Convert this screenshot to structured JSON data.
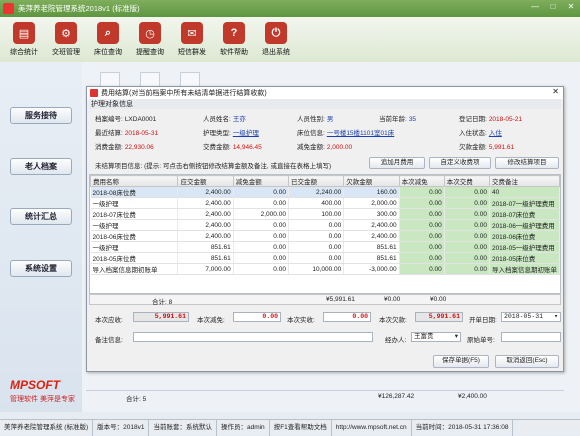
{
  "app": {
    "title": "美萍养老院管理系统2018v1 (标准版)",
    "min": "—",
    "max": "□",
    "close": "✕"
  },
  "toolbar": [
    {
      "label": "综合统计",
      "icon": "chart-icon",
      "color": "#c0392b"
    },
    {
      "label": "交班管理",
      "icon": "handover-icon",
      "color": "#c0392b"
    },
    {
      "label": "床位查询",
      "icon": "bed-search-icon",
      "color": "#c0392b"
    },
    {
      "label": "提醒查询",
      "icon": "reminder-icon",
      "color": "#c0392b"
    },
    {
      "label": "短信群发",
      "icon": "sms-icon",
      "color": "#c0392b"
    },
    {
      "label": "软件帮助",
      "icon": "help-icon",
      "color": "#c0392b"
    },
    {
      "label": "退出系统",
      "icon": "exit-icon",
      "color": "#c0392b"
    }
  ],
  "sidebar": [
    "服务接待",
    "老人档案",
    "统计汇总",
    "系统设置"
  ],
  "brand": {
    "logo": "MPSOFT",
    "tag1": "管理软件",
    "tag2": "美萍是专家"
  },
  "dialog": {
    "title": "费用结算(对当前档案中所有未结清单据进行结算收款)",
    "close": "✕",
    "section": "护理对象信息",
    "fields": [
      {
        "k": "档案编号:",
        "v": "LXDA0001"
      },
      {
        "k": "人员姓名:",
        "v": "王亦"
      },
      {
        "k": "人员性别:",
        "v": "男"
      },
      {
        "k": "当前年龄:",
        "v": "35"
      },
      {
        "k": "登记日期:",
        "v": "2018-05-21"
      },
      {
        "k": "最近结算:",
        "v": "2018-05-31"
      },
      {
        "k": "护理类型:",
        "v": "一级护理"
      },
      {
        "k": "床位信息:",
        "v": "一号楼15楼1101室01床"
      },
      {
        "k": "入住状态:",
        "v": "入住"
      },
      {
        "k": "消费金额:",
        "v": "22,930.06"
      },
      {
        "k": "交费金额:",
        "v": "14,946.45"
      },
      {
        "k": "减免金额:",
        "v": "2,000.00"
      },
      {
        "k": "欠款金额:",
        "v": "5,991.61"
      }
    ],
    "pending_label": "未结算项目信息: (提示: 可点击右侧按钮修改结算金额及备注, 或直接在表格上填写)",
    "btn_add": "追加月费用",
    "btn_custom": "自定义收费项",
    "btn_modify": "修改结算项目",
    "columns": [
      "费用名称",
      "应交金额",
      "减免金额",
      "已交金额",
      "欠款金额",
      "本次减免",
      "本次交费",
      "交费备注"
    ],
    "rows": [
      [
        "2018-08床位费",
        "2,400.00",
        "0.00",
        "2,240.00",
        "160.00",
        "0.00",
        "0.00",
        "40"
      ],
      [
        "一级护理",
        "2,400.00",
        "0.00",
        "400.00",
        "2,000.00",
        "0.00",
        "0.00",
        "2018-07一级护理费用"
      ],
      [
        "2018-07床位费",
        "2,400.00",
        "2,000.00",
        "100.00",
        "300.00",
        "0.00",
        "0.00",
        "2018-07床位费"
      ],
      [
        "一级护理",
        "2,400.00",
        "0.00",
        "0.00",
        "2,400.00",
        "0.00",
        "0.00",
        "2018-06一级护理费用"
      ],
      [
        "2018-06床位费",
        "2,400.00",
        "0.00",
        "0.00",
        "2,400.00",
        "0.00",
        "0.00",
        "2018-06床位费"
      ],
      [
        "一级护理",
        "851.61",
        "0.00",
        "0.00",
        "851.61",
        "0.00",
        "0.00",
        "2018-05一级护理费用"
      ],
      [
        "2018-05床位费",
        "851.61",
        "0.00",
        "0.00",
        "851.61",
        "0.00",
        "0.00",
        "2018-05床位费"
      ],
      [
        "导入档案信息期初账单",
        "7,000.00",
        "0.00",
        "10,000.00",
        "-3,000.00",
        "0.00",
        "0.00",
        "导入档案信息期初账单"
      ]
    ],
    "sum_count": "合计: 8",
    "sum_debt": "¥5,991.61",
    "sum_relief": "¥0.00",
    "sum_paid": "¥0.00",
    "pay": {
      "due_label": "本次应收:",
      "due": "5,991.61",
      "relief_label": "本次减免:",
      "relief": "0.00",
      "actual_label": "本次实收:",
      "actual": "0.00",
      "debt_label": "本次欠款:",
      "debt": "5,991.61",
      "date_label": "开单日期:",
      "date": "2018-05-31",
      "note_label": "备注信息:",
      "note": "",
      "handler_label": "经办人:",
      "handler": "王富贵",
      "orig_label": "原始单号:",
      "orig": ""
    },
    "btn_save": "保存单据(F5)",
    "btn_cancel": "取消返回(Esc)"
  },
  "pager": {
    "total": "合计: 5",
    "v1": "¥126,287.42",
    "v2": "¥2,400.00"
  },
  "status": [
    "美萍养老院管理系统 (标准版)",
    "版本号：2018v1",
    "当前账套：系统默认",
    "操作员：admin",
    "按F1查看帮助文档",
    "http://www.mpsoft.net.cn",
    "当前时间：2018-05-31 17:36:08"
  ]
}
